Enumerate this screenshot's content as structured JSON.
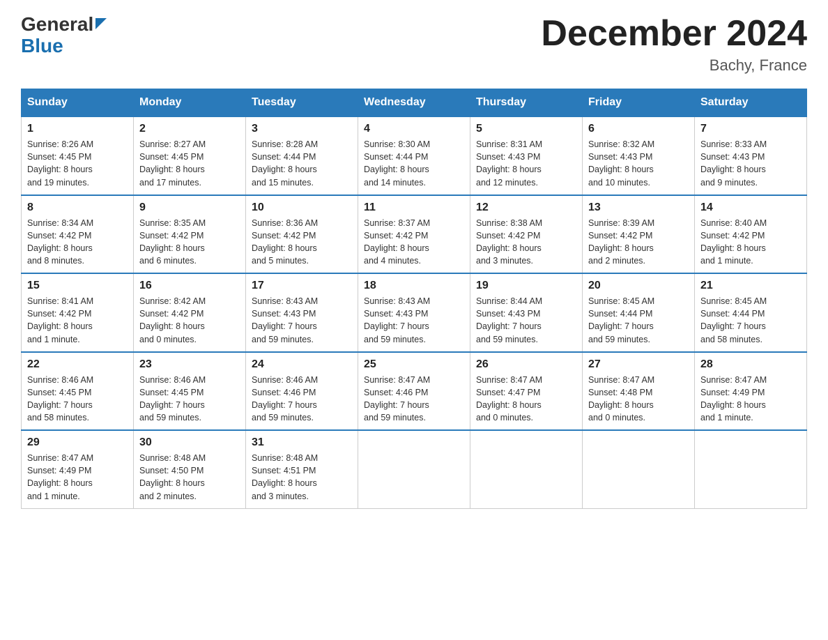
{
  "header": {
    "logo_line1": "General",
    "logo_line2": "Blue",
    "month_title": "December 2024",
    "location": "Bachy, France"
  },
  "weekdays": [
    "Sunday",
    "Monday",
    "Tuesday",
    "Wednesday",
    "Thursday",
    "Friday",
    "Saturday"
  ],
  "weeks": [
    [
      {
        "day": "1",
        "sunrise": "8:26 AM",
        "sunset": "4:45 PM",
        "daylight": "8 hours and 19 minutes."
      },
      {
        "day": "2",
        "sunrise": "8:27 AM",
        "sunset": "4:45 PM",
        "daylight": "8 hours and 17 minutes."
      },
      {
        "day": "3",
        "sunrise": "8:28 AM",
        "sunset": "4:44 PM",
        "daylight": "8 hours and 15 minutes."
      },
      {
        "day": "4",
        "sunrise": "8:30 AM",
        "sunset": "4:44 PM",
        "daylight": "8 hours and 14 minutes."
      },
      {
        "day": "5",
        "sunrise": "8:31 AM",
        "sunset": "4:43 PM",
        "daylight": "8 hours and 12 minutes."
      },
      {
        "day": "6",
        "sunrise": "8:32 AM",
        "sunset": "4:43 PM",
        "daylight": "8 hours and 10 minutes."
      },
      {
        "day": "7",
        "sunrise": "8:33 AM",
        "sunset": "4:43 PM",
        "daylight": "8 hours and 9 minutes."
      }
    ],
    [
      {
        "day": "8",
        "sunrise": "8:34 AM",
        "sunset": "4:42 PM",
        "daylight": "8 hours and 8 minutes."
      },
      {
        "day": "9",
        "sunrise": "8:35 AM",
        "sunset": "4:42 PM",
        "daylight": "8 hours and 6 minutes."
      },
      {
        "day": "10",
        "sunrise": "8:36 AM",
        "sunset": "4:42 PM",
        "daylight": "8 hours and 5 minutes."
      },
      {
        "day": "11",
        "sunrise": "8:37 AM",
        "sunset": "4:42 PM",
        "daylight": "8 hours and 4 minutes."
      },
      {
        "day": "12",
        "sunrise": "8:38 AM",
        "sunset": "4:42 PM",
        "daylight": "8 hours and 3 minutes."
      },
      {
        "day": "13",
        "sunrise": "8:39 AM",
        "sunset": "4:42 PM",
        "daylight": "8 hours and 2 minutes."
      },
      {
        "day": "14",
        "sunrise": "8:40 AM",
        "sunset": "4:42 PM",
        "daylight": "8 hours and 1 minute."
      }
    ],
    [
      {
        "day": "15",
        "sunrise": "8:41 AM",
        "sunset": "4:42 PM",
        "daylight": "8 hours and 1 minute."
      },
      {
        "day": "16",
        "sunrise": "8:42 AM",
        "sunset": "4:42 PM",
        "daylight": "8 hours and 0 minutes."
      },
      {
        "day": "17",
        "sunrise": "8:43 AM",
        "sunset": "4:43 PM",
        "daylight": "7 hours and 59 minutes."
      },
      {
        "day": "18",
        "sunrise": "8:43 AM",
        "sunset": "4:43 PM",
        "daylight": "7 hours and 59 minutes."
      },
      {
        "day": "19",
        "sunrise": "8:44 AM",
        "sunset": "4:43 PM",
        "daylight": "7 hours and 59 minutes."
      },
      {
        "day": "20",
        "sunrise": "8:45 AM",
        "sunset": "4:44 PM",
        "daylight": "7 hours and 59 minutes."
      },
      {
        "day": "21",
        "sunrise": "8:45 AM",
        "sunset": "4:44 PM",
        "daylight": "7 hours and 58 minutes."
      }
    ],
    [
      {
        "day": "22",
        "sunrise": "8:46 AM",
        "sunset": "4:45 PM",
        "daylight": "7 hours and 58 minutes."
      },
      {
        "day": "23",
        "sunrise": "8:46 AM",
        "sunset": "4:45 PM",
        "daylight": "7 hours and 59 minutes."
      },
      {
        "day": "24",
        "sunrise": "8:46 AM",
        "sunset": "4:46 PM",
        "daylight": "7 hours and 59 minutes."
      },
      {
        "day": "25",
        "sunrise": "8:47 AM",
        "sunset": "4:46 PM",
        "daylight": "7 hours and 59 minutes."
      },
      {
        "day": "26",
        "sunrise": "8:47 AM",
        "sunset": "4:47 PM",
        "daylight": "8 hours and 0 minutes."
      },
      {
        "day": "27",
        "sunrise": "8:47 AM",
        "sunset": "4:48 PM",
        "daylight": "8 hours and 0 minutes."
      },
      {
        "day": "28",
        "sunrise": "8:47 AM",
        "sunset": "4:49 PM",
        "daylight": "8 hours and 1 minute."
      }
    ],
    [
      {
        "day": "29",
        "sunrise": "8:47 AM",
        "sunset": "4:49 PM",
        "daylight": "8 hours and 1 minute."
      },
      {
        "day": "30",
        "sunrise": "8:48 AM",
        "sunset": "4:50 PM",
        "daylight": "8 hours and 2 minutes."
      },
      {
        "day": "31",
        "sunrise": "8:48 AM",
        "sunset": "4:51 PM",
        "daylight": "8 hours and 3 minutes."
      },
      null,
      null,
      null,
      null
    ]
  ],
  "labels": {
    "sunrise": "Sunrise:",
    "sunset": "Sunset:",
    "daylight": "Daylight:"
  }
}
